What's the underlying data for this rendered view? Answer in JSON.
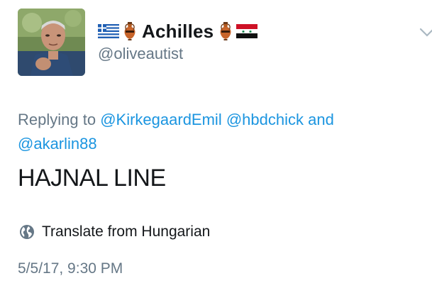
{
  "author": {
    "display_name": "Achilles",
    "handle": "@oliveautist",
    "icons": [
      "greek-flag-icon",
      "amphora-icon",
      "amphora-icon",
      "syrian-flag-icon"
    ]
  },
  "reply": {
    "prefix": "Replying to",
    "mentions": [
      "@KirkegaardEmil",
      "@hbdchick",
      "@akarlin88"
    ],
    "conjunction": "and"
  },
  "tweet": {
    "text": "HAJNAL LINE",
    "translate_label": "Translate from Hungarian",
    "timestamp": "5/5/17, 9:30 PM"
  },
  "colors": {
    "link": "#1b95e0",
    "secondary_text": "#657786",
    "primary_text": "#14171a"
  }
}
